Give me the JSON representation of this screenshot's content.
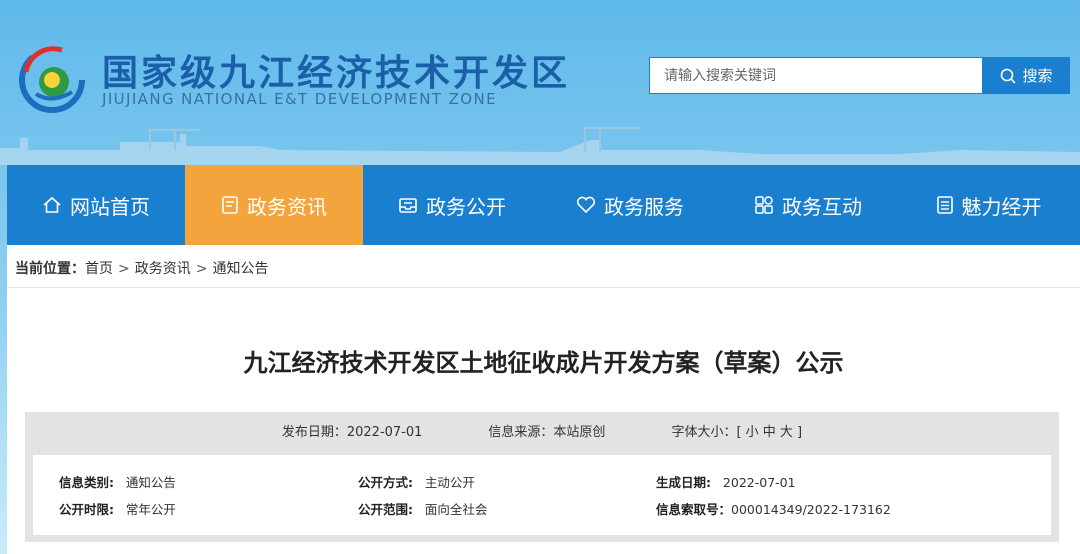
{
  "header": {
    "title_cn": "国家级九江经济技术开发区",
    "title_en": "JIUJIANG NATIONAL E&T DEVELOPMENT ZONE",
    "logo_icon": "jiujiang-logo-icon"
  },
  "search": {
    "placeholder": "请输入搜索关键词",
    "button_label": "搜索"
  },
  "nav": {
    "items": [
      {
        "label": "网站首页",
        "icon": "home-icon"
      },
      {
        "label": "政务资讯",
        "icon": "document-icon"
      },
      {
        "label": "政务公开",
        "icon": "inbox-icon"
      },
      {
        "label": "政务服务",
        "icon": "heart-icon"
      },
      {
        "label": "政务互动",
        "icon": "interaction-icon"
      },
      {
        "label": "魅力经开",
        "icon": "list-icon"
      }
    ]
  },
  "breadcrumb": {
    "prefix": "当前位置：",
    "items": [
      "首页",
      "政务资讯",
      "通知公告"
    ],
    "separator": ">"
  },
  "article": {
    "title": "九江经济技术开发区土地征收成片开发方案（草案）公示",
    "publish_date": "发布日期：2022-07-01",
    "source": "信息来源：本站原创",
    "font_size_label": "字体大小：[ 小 中 大 ]"
  },
  "info": {
    "category_label": "信息类别:",
    "category_value": "通知公告",
    "open_mode_label": "公开方式:",
    "open_mode_value": "主动公开",
    "created_label": "生成日期:",
    "created_value": "2022-07-01",
    "open_time_label": "公开时限:",
    "open_time_value": "常年公开",
    "scope_label": "公开范围:",
    "scope_value": "面向全社会",
    "index_label": "信息索取号：",
    "index_value": "000014349/2022-173162"
  },
  "colors": {
    "nav_blue": "#1b7fcf",
    "nav_active": "#f3a43c",
    "brand_blue": "#1a5fa8"
  }
}
